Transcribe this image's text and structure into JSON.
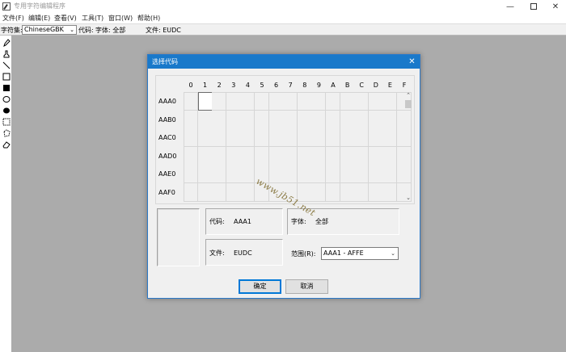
{
  "app": {
    "title": "专用字符编辑程序",
    "window_controls": {
      "minimize": "—",
      "close": "✕"
    }
  },
  "menu": [
    "文件(F)",
    "编辑(E)",
    "查看(V)",
    "工具(T)",
    "窗口(W)",
    "帮助(H)"
  ],
  "toolbar": {
    "charset_label": "字符集:",
    "charset_value": "ChineseGBK",
    "code_label": "代码:",
    "font_label": "字体: 全部",
    "file_label": "文件: EUDC"
  },
  "tools": [
    "pencil-icon",
    "brush-icon",
    "line-icon",
    "hollow-rect-icon",
    "filled-rect-icon",
    "hollow-ellipse-icon",
    "filled-ellipse-icon",
    "rect-select-icon",
    "freeform-select-icon",
    "eraser-icon"
  ],
  "dialog": {
    "title": "选择代码",
    "close": "✕",
    "columns": [
      "0",
      "1",
      "2",
      "3",
      "4",
      "5",
      "6",
      "7",
      "8",
      "9",
      "A",
      "B",
      "C",
      "D",
      "E",
      "F"
    ],
    "rows": [
      "AAA0",
      "AAB0",
      "AAC0",
      "AAD0",
      "AAE0",
      "AAF0"
    ],
    "selected_cell": {
      "row": 0,
      "col": 1
    },
    "code_label": "代码:",
    "code_value": "AAA1",
    "font_label": "字体:",
    "font_value": "全部",
    "file_label": "文件:",
    "file_value": "EUDC",
    "range_label": "范围(R):",
    "range_value": "AAA1 - AFFE",
    "ok_label": "确定",
    "cancel_label": "取消"
  },
  "watermark": "www.jb51.net"
}
